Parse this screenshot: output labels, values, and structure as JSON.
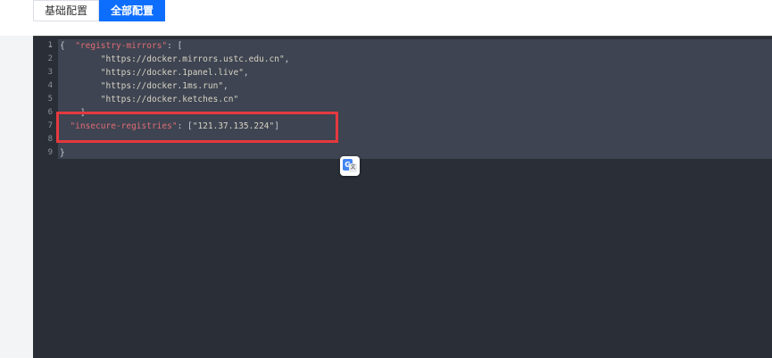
{
  "tabs": [
    {
      "label": "基础配置",
      "active": false
    },
    {
      "label": "全部配置",
      "active": true
    }
  ],
  "editor": {
    "line_numbers": [
      "1",
      "2",
      "3",
      "4",
      "5",
      "6",
      "7",
      "8",
      "9"
    ],
    "fold_marker": "⌄",
    "lines": [
      {
        "parts": [
          {
            "t": "{",
            "c": "punc"
          },
          {
            "t": "  ",
            "c": "punc"
          },
          {
            "t": "\"registry-mirrors\"",
            "c": "key"
          },
          {
            "t": ": [",
            "c": "punc"
          }
        ]
      },
      {
        "parts": [
          {
            "t": "        ",
            "c": "punc"
          },
          {
            "t": "\"https://docker.mirrors.ustc.edu.cn\"",
            "c": "str"
          },
          {
            "t": ",",
            "c": "punc"
          }
        ]
      },
      {
        "parts": [
          {
            "t": "        ",
            "c": "punc"
          },
          {
            "t": "\"https://docker.1panel.live\"",
            "c": "str"
          },
          {
            "t": ",",
            "c": "punc"
          }
        ]
      },
      {
        "parts": [
          {
            "t": "        ",
            "c": "punc"
          },
          {
            "t": "\"https://docker.1ms.run\"",
            "c": "str"
          },
          {
            "t": ",",
            "c": "punc"
          }
        ]
      },
      {
        "parts": [
          {
            "t": "        ",
            "c": "punc"
          },
          {
            "t": "\"https://docker.ketches.cn\"",
            "c": "str"
          }
        ]
      },
      {
        "parts": [
          {
            "t": "    ]",
            "c": "punc"
          }
        ]
      },
      {
        "parts": [
          {
            "t": "  ",
            "c": "punc"
          },
          {
            "t": "\"insecure-registries\"",
            "c": "key"
          },
          {
            "t": ": [",
            "c": "punc"
          },
          {
            "t": "\"121.37.135.224\"",
            "c": "str"
          },
          {
            "t": "]",
            "c": "punc"
          }
        ]
      },
      {
        "parts": [
          {
            "t": "",
            "c": "punc"
          }
        ]
      },
      {
        "parts": [
          {
            "t": "}",
            "c": "punc"
          }
        ]
      }
    ]
  },
  "colors": {
    "editor_bg": "#2a2e36",
    "selection": "#3e4451",
    "key": "#e06c75",
    "highlight_box": "#e5393f",
    "tab_active": "#0d6efd"
  },
  "translate_icon": {
    "g": "G",
    "x": "文"
  }
}
